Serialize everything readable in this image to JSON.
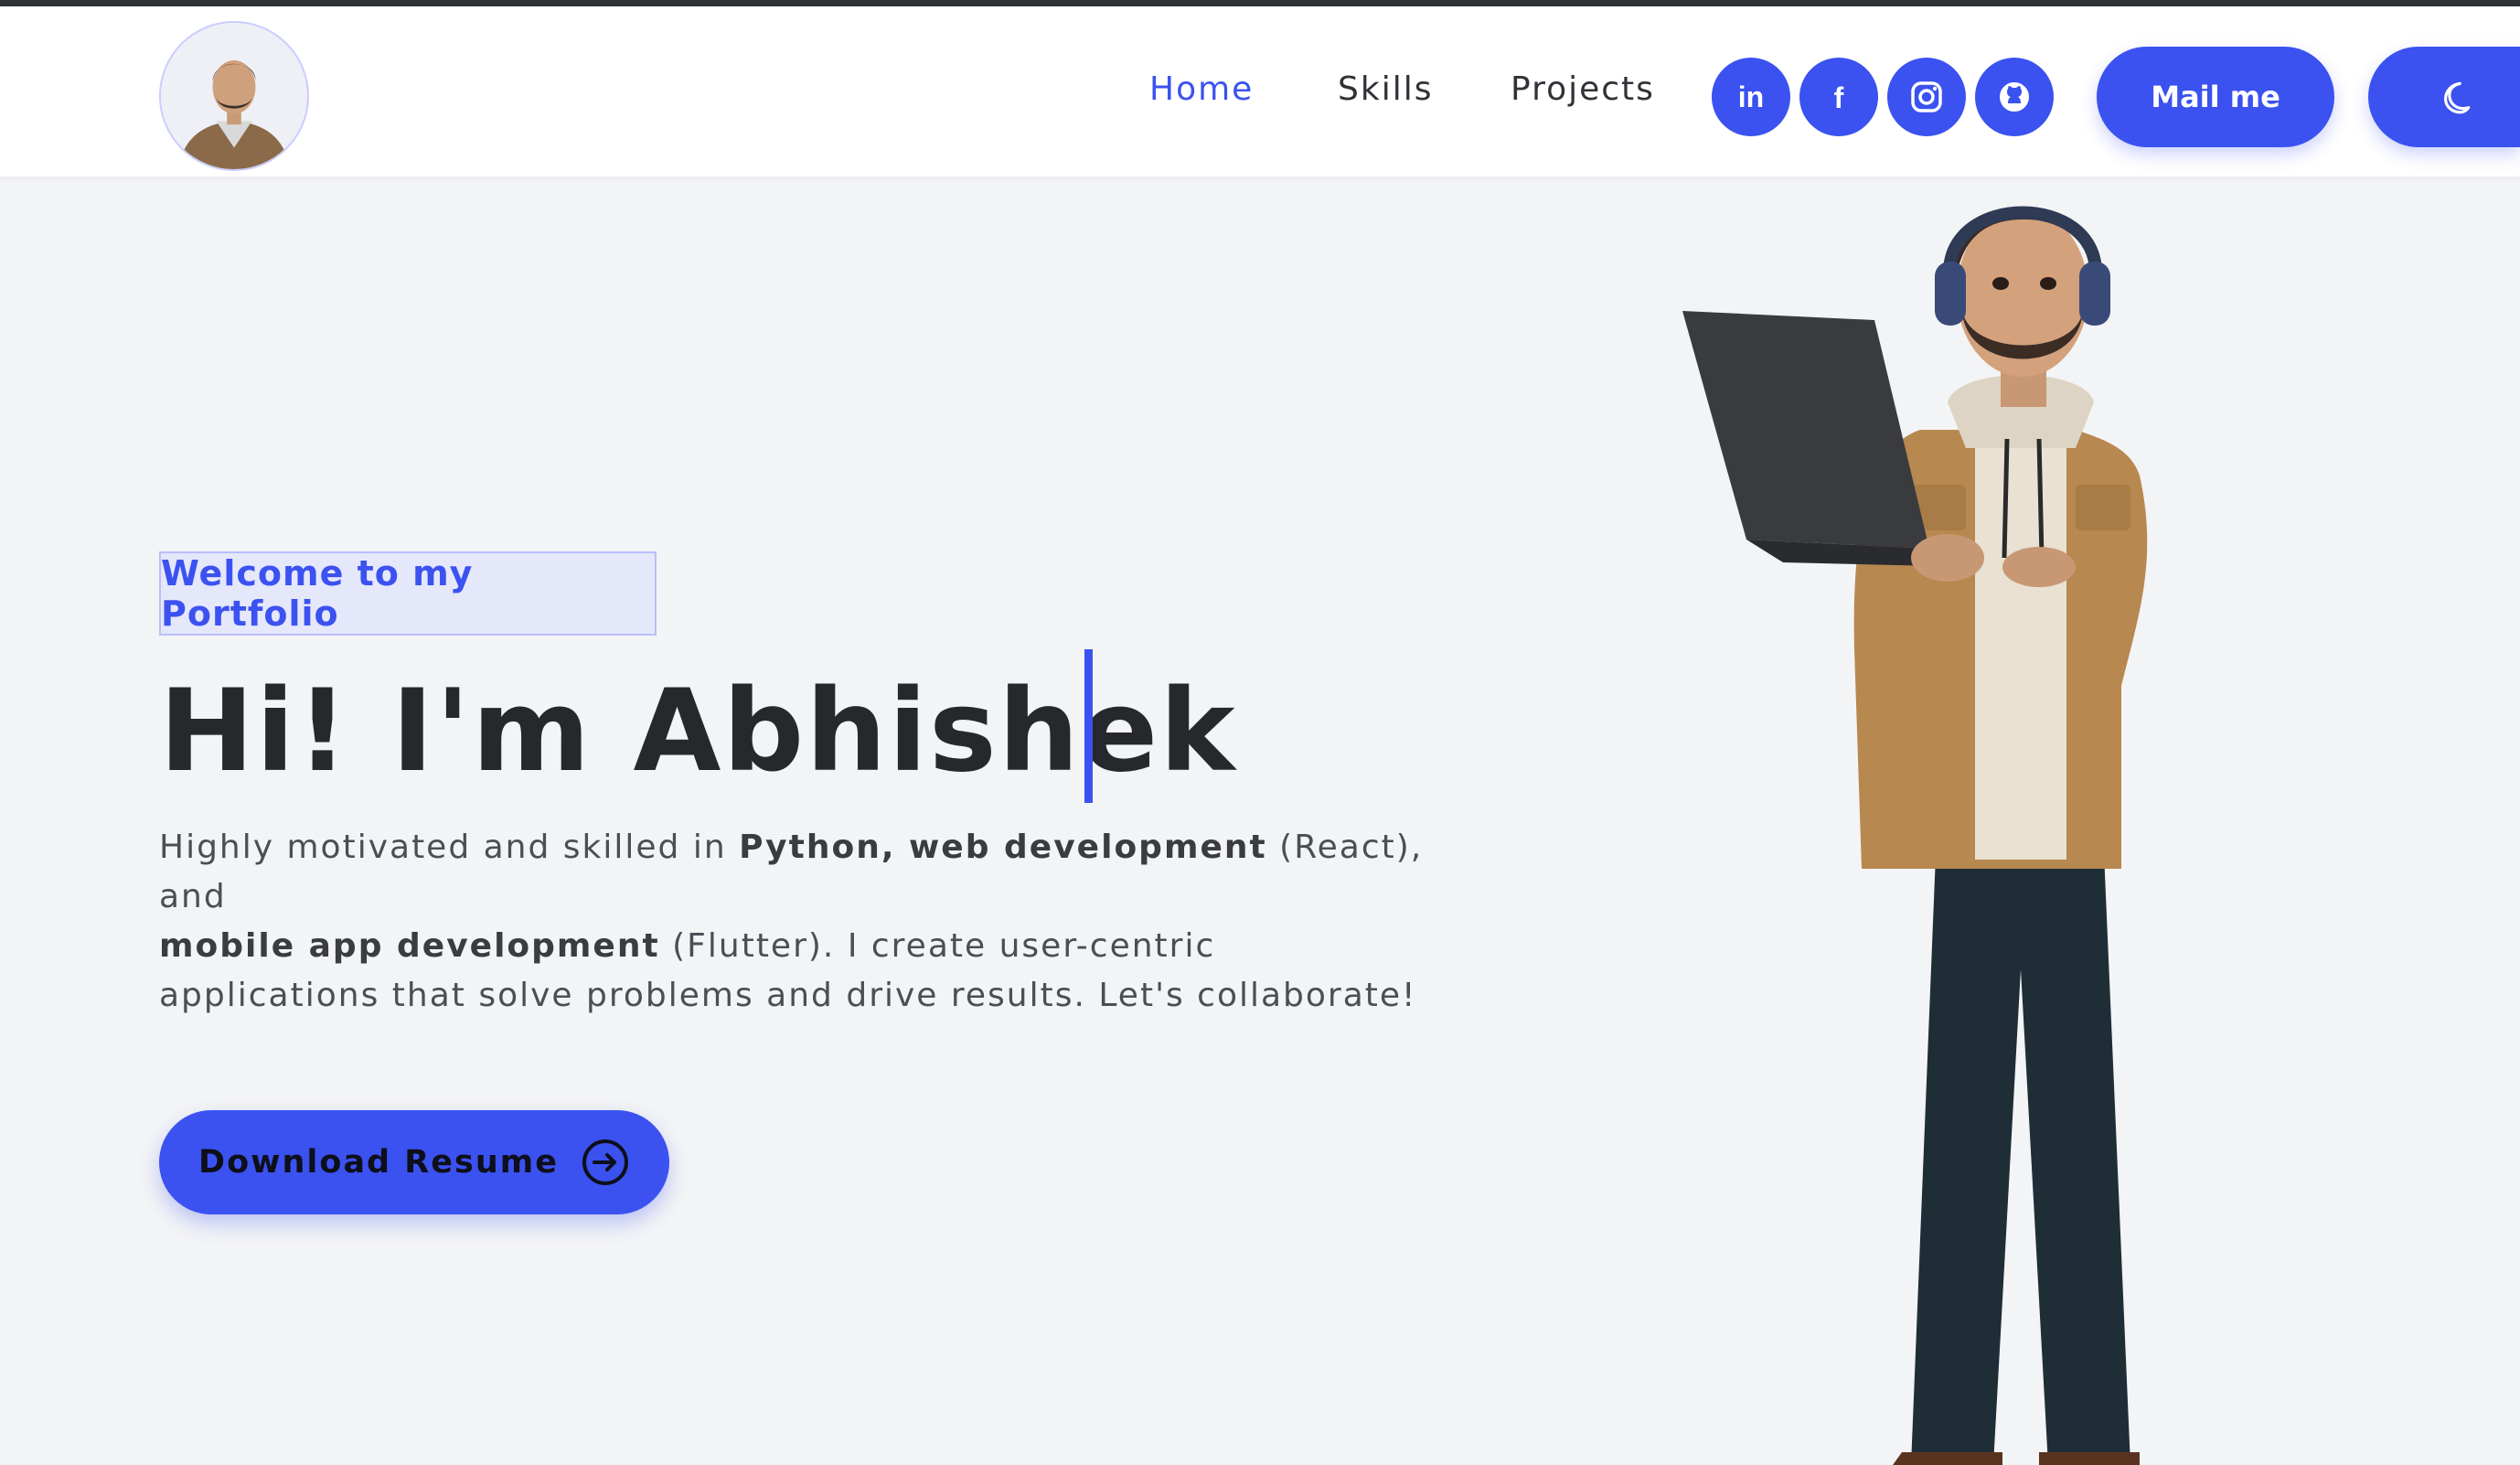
{
  "nav": {
    "links": [
      {
        "label": "Home",
        "active": true
      },
      {
        "label": "Skills",
        "active": false
      },
      {
        "label": "Projects",
        "active": false
      }
    ],
    "socials": [
      {
        "icon": "linkedin-icon",
        "text": "in"
      },
      {
        "icon": "facebook-icon",
        "text": "f"
      },
      {
        "icon": "instagram-icon"
      },
      {
        "icon": "github-icon"
      }
    ],
    "mail_label": "Mail me",
    "theme_icon": "moon-icon"
  },
  "hero": {
    "welcome": "Welcome to my Portfolio",
    "title": "Hi! I'm Abhishek",
    "desc": {
      "p1": "Highly motivated and skilled in ",
      "b1": "Python, web development",
      "p2": " (React), and ",
      "b2": "mobile app development",
      "p3": " (Flutter). I create user-centric applications that solve problems and drive results. Let's collaborate!"
    },
    "resume_label": "Download Resume",
    "resume_icon": "arrow-right-circle-icon"
  },
  "colors": {
    "accent": "#3b52f0",
    "background": "#f3f4f6",
    "nav_bg": "#ffffff",
    "text_dark": "#26282c",
    "text_body": "#4b4e55"
  }
}
